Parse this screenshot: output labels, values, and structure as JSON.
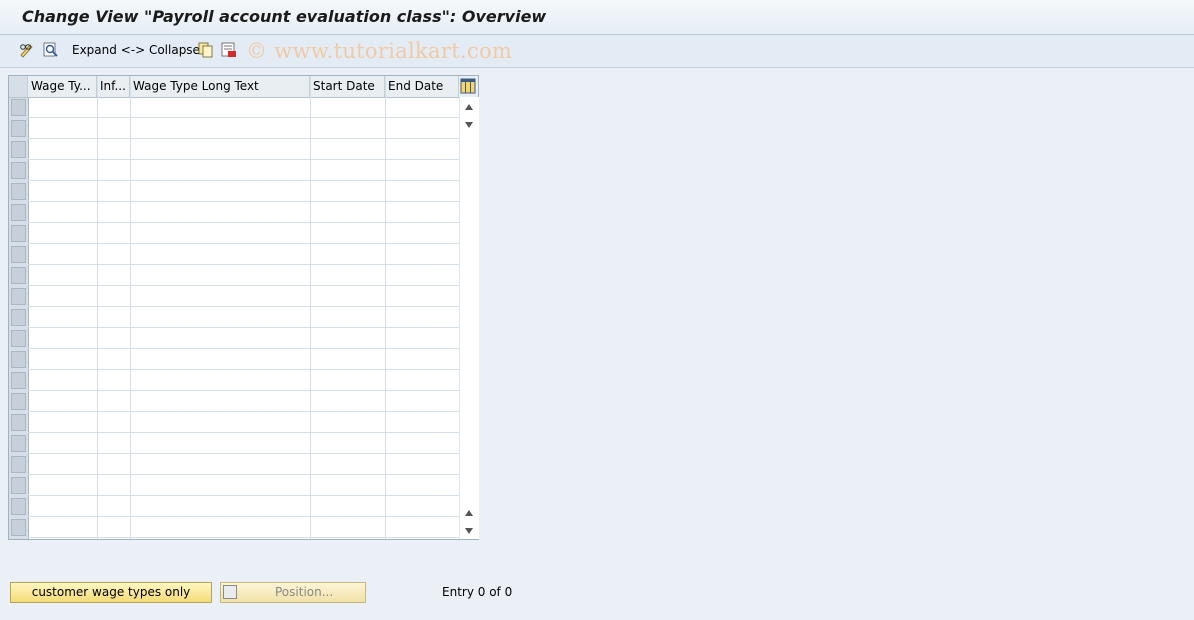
{
  "window": {
    "title": "Change View \"Payroll account evaluation class\": Overview"
  },
  "toolbar": {
    "edit_icon": "pencil-glasses-icon",
    "find_icon": "find-icon",
    "expand_collapse_label": "Expand <-> Collapse",
    "copy_icon": "copy-icon",
    "delete_icon": "delete-icon",
    "watermark": "© www.tutorialkart.com"
  },
  "table": {
    "columns": [
      "Wage Ty...",
      "Inf...",
      "Wage Type Long Text",
      "Start Date",
      "End Date"
    ],
    "config_icon": "table-settings-icon",
    "visible_rows": 21,
    "rows": []
  },
  "footer": {
    "customer_button_label": "customer wage types only",
    "position_button_label": "Position...",
    "entry_text": "Entry 0 of 0"
  },
  "colors": {
    "title_text": "#1b1b1b",
    "button_yellow": "#f5dc77",
    "watermark": "#f1c9a5"
  }
}
